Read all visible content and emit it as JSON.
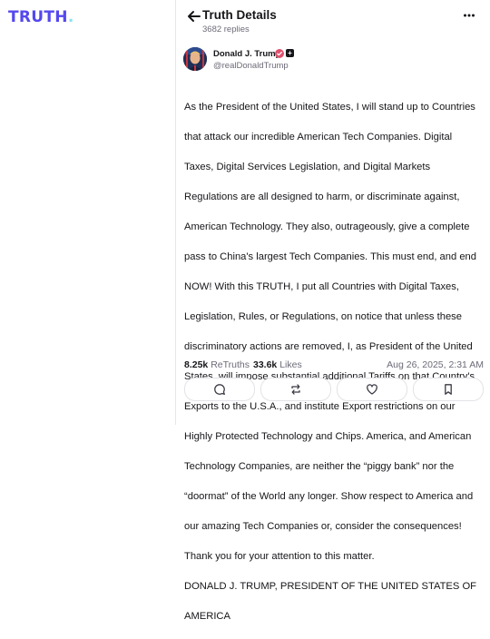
{
  "brand": {
    "logo_text": "TRUTH",
    "logo_dot": ".",
    "primary": "#5448ee",
    "accent": "#8ee0f0"
  },
  "header": {
    "title": "Truth Details",
    "replies": "3682 replies",
    "back_icon": "arrow-left-icon",
    "more_icon": "more-horizontal-icon"
  },
  "author": {
    "name": "Donald J. Trump",
    "handle": "@realDonaldTrump",
    "badge_icon": "verified-badge-icon"
  },
  "post": {
    "lines": [
      "As the President of the United States, I will stand up to Countries",
      "that attack our incredible American Tech Companies. Digital",
      "Taxes, Digital Services Legislation, and Digital Markets",
      "Regulations are all designed to harm, or discriminate against,",
      "American Technology. They also, outrageously, give a complete",
      "pass to China's largest Tech Companies. This must end, and end",
      "NOW! With this TRUTH, I put all Countries with Digital Taxes,",
      "Legislation, Rules, or Regulations, on notice that unless these",
      "discriminatory actions are removed, I, as President of the United",
      "States, will impose substantial additional Tariffs on that Country's",
      "Exports to the U.S.A., and institute Export restrictions on our",
      "Highly Protected Technology and Chips. America, and American",
      "Technology Companies, are neither the “piggy bank” nor the",
      "“doormat” of the World any longer. Show respect to America and",
      "our amazing Tech Companies or, consider the consequences!",
      "Thank you for your attention to this matter.",
      "DONALD J. TRUMP, PRESIDENT OF THE UNITED STATES OF",
      "AMERICA"
    ]
  },
  "stats": {
    "retruths_count": "8.25k",
    "retruths_label": "ReTruths",
    "likes_count": "33.6k",
    "likes_label": "Likes",
    "date": "Aug 26, 2025, 2:31 AM"
  },
  "actions": [
    {
      "icon": "reply-icon"
    },
    {
      "icon": "retruth-icon"
    },
    {
      "icon": "like-icon"
    },
    {
      "icon": "bookmark-icon"
    }
  ]
}
